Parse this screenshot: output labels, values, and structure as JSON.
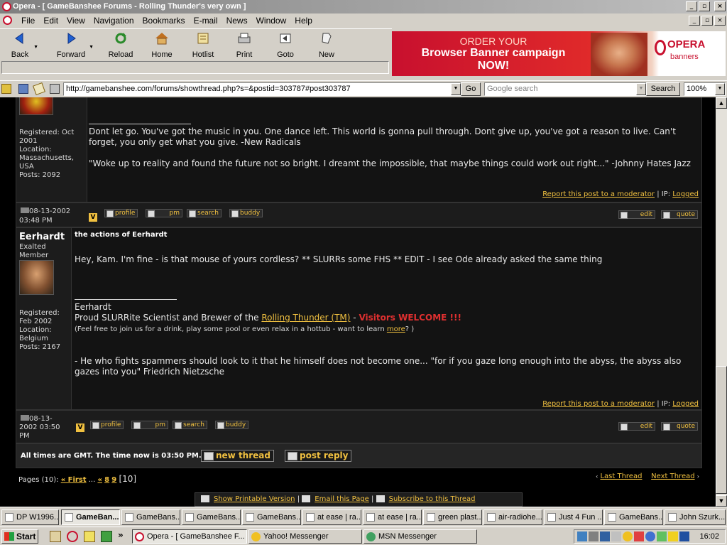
{
  "window": {
    "title": "Opera - [ GameBanshee Forums - Rolling Thunder's very own ]",
    "controls": [
      "_",
      "▫",
      "×"
    ],
    "mdi_controls": [
      "_",
      "▫",
      "×"
    ]
  },
  "menu": [
    "File",
    "Edit",
    "View",
    "Navigation",
    "Bookmarks",
    "E-mail",
    "News",
    "Window",
    "Help"
  ],
  "toolbar": [
    {
      "label": "Back",
      "icon": "back-arrow-icon"
    },
    {
      "label": "Forward",
      "icon": "forward-arrow-icon"
    },
    {
      "label": "Reload",
      "icon": "reload-icon"
    },
    {
      "label": "Home",
      "icon": "home-icon"
    },
    {
      "label": "Hotlist",
      "icon": "hotlist-icon"
    },
    {
      "label": "Print",
      "icon": "printer-icon"
    },
    {
      "label": "Goto",
      "icon": "goto-icon"
    },
    {
      "label": "New",
      "icon": "new-page-icon"
    }
  ],
  "banner": {
    "line1": "ORDER YOUR",
    "line2": "Browser Banner campaign",
    "line3": "NOW!",
    "logo_main": "OPERA",
    "logo_sub": "banners"
  },
  "address": {
    "url": "http://gamebanshee.com/forums/showthread.php?s=&postid=303787#post303787",
    "go": "Go",
    "search_placeholder": "Google search",
    "search_button": "Search",
    "zoom": "100%"
  },
  "post1": {
    "registered": "Registered: Oct 2001",
    "location_label": "Location:",
    "location": "Massachusetts, USA",
    "posts": "Posts: 2092",
    "sig_p1": "Dont let go. You've got the music in you. One dance left. This world is gonna pull through. Dont give up, you've got a reason to live. Can't forget, you only get what you give. -New Radicals",
    "sig_p2": "\"Woke up to reality and found the future not so bright. I dreamt the impossible, that maybe things could work out right...\" -Johnny Hates Jazz",
    "report": "Report this post to a moderator",
    "ip_label": "| IP:",
    "ip": "Logged",
    "date": "08-13-2002",
    "time": "03:48 PM"
  },
  "post2": {
    "user": "Eerhardt",
    "rank": "Exalted Member",
    "title": "the actions of Eerhardt",
    "body": "Hey, Kam. I'm fine - is that mouse of yours cordless? ** SLURRs some FHS ** EDIT - I see Ode already asked the same thing",
    "registered_label": "Registered:",
    "registered": "Feb 2002",
    "location_label": "Location:",
    "location": "Belgium",
    "posts": "Posts: 2167",
    "sig_name": "Eerhardt",
    "sig_pre": "Proud SLURRite Scientist and Brewer of the ",
    "sig_link": "Rolling Thunder (TM)",
    "sig_dash": " - ",
    "sig_red": "Visitors WELCOME !!!",
    "sig_small_pre": "(Feel free to join us for a drink, play some pool or even relax in a hottub - want to learn ",
    "sig_small_link": "more",
    "sig_small_post": "? )",
    "quote": "- He who fights spammers should look to it that he himself does not become one... \"for if you gaze long enough into the abyss, the abyss also gazes into you\" Friedrich Nietzsche",
    "report": "Report this post to a moderator",
    "ip_label": "| IP:",
    "ip": "Logged",
    "date": "08-13-",
    "date2": "2002 03:50",
    "date3": "PM"
  },
  "post_buttons": {
    "v": "V",
    "profile": "profile",
    "pm": "pm",
    "search": "search",
    "buddy": "buddy",
    "edit": "edit",
    "quote": "quote"
  },
  "footer": {
    "times": "All times are GMT. The time now is 03:50 PM.",
    "new_thread": "new thread",
    "post_reply": "post reply",
    "pages_label": "Pages (10):",
    "first": "« First",
    "ellipsis": "...",
    "prev": "«",
    "p8": "8",
    "p9": "9",
    "current": "[10]",
    "last_thread": "Last Thread",
    "next_thread": "Next Thread",
    "printable": "Show Printable Version",
    "email": "Email this Page",
    "subscribe": "Subscribe to this Thread",
    "sep": "|"
  },
  "taskbar_windows": [
    "DP W1996...",
    "GameBan...",
    "GameBans...",
    "GameBans...",
    "GameBans...",
    "at ease | ra...",
    "at ease | ra...",
    "green plast...",
    "air-radiohe...",
    "Just 4 Fun ...",
    "GameBans...",
    "John Szurk..."
  ],
  "taskbar": {
    "start": "Start",
    "more": "»",
    "apps": [
      "Opera - [ GameBanshee F...",
      "Yahoo! Messenger",
      "MSN Messenger"
    ],
    "clock": "16:02"
  }
}
